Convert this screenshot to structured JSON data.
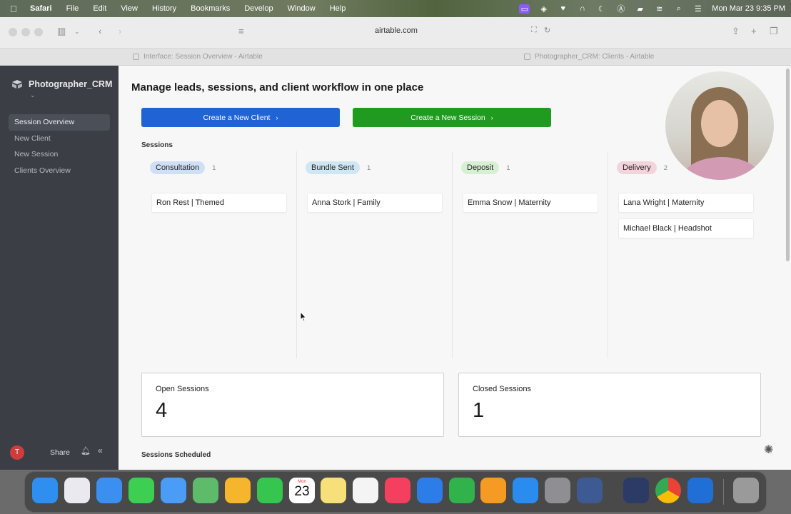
{
  "menubar": {
    "app_name": "Safari",
    "menus": [
      "File",
      "Edit",
      "View",
      "History",
      "Bookmarks",
      "Develop",
      "Window",
      "Help"
    ],
    "clock": "Mon Mar 23  9:35 PM"
  },
  "browser": {
    "url": "airtable.com",
    "tabs": [
      {
        "title": "Interface: Session Overview - Airtable"
      },
      {
        "title": "Photographer_CRM: Clients - Airtable"
      }
    ]
  },
  "sidebar": {
    "app_name": "Photographer_CRM",
    "items": [
      {
        "label": "Session Overview",
        "active": true
      },
      {
        "label": "New Client"
      },
      {
        "label": "New Session"
      },
      {
        "label": "Clients Overview"
      }
    ],
    "avatar_initial": "T",
    "share_label": "Share"
  },
  "main": {
    "title": "Manage leads, sessions, and client workflow in one place",
    "buttons": {
      "new_client": "Create a New Client",
      "new_session": "Create a New Session"
    },
    "sessions_label": "Sessions",
    "columns": [
      {
        "name": "Consultation",
        "count": "1",
        "color": "#cfe0f6",
        "cards": [
          "Ron Rest | Themed"
        ]
      },
      {
        "name": "Bundle Sent",
        "count": "1",
        "color": "#cfe7f3",
        "cards": [
          "Anna Stork | Family"
        ]
      },
      {
        "name": "Deposit",
        "count": "1",
        "color": "#d7efd3",
        "cards": [
          "Emma Snow | Maternity"
        ]
      },
      {
        "name": "Delivery",
        "count": "2",
        "color": "#f3d4dd",
        "cards": [
          "Lana Wright | Maternity",
          "Michael Black | Headshot"
        ]
      }
    ],
    "stats": {
      "open_label": "Open Sessions",
      "open_value": "4",
      "closed_label": "Closed Sessions",
      "closed_value": "1"
    },
    "scheduled_label": "Sessions Scheduled"
  },
  "dock": {
    "calendar_month": "Mon",
    "calendar_day": "23",
    "apps": [
      {
        "icon": "finder-icon",
        "color": "#2f8ff0"
      },
      {
        "icon": "launchpad-icon",
        "color": "#e9e9ef"
      },
      {
        "icon": "safari-icon",
        "color": "#3a8ff0"
      },
      {
        "icon": "messages-icon",
        "color": "#3ccf52"
      },
      {
        "icon": "mail-icon",
        "color": "#4a9cf6"
      },
      {
        "icon": "maps-icon",
        "color": "#5dbb6a"
      },
      {
        "icon": "photos-icon",
        "color": "#f5b52c"
      },
      {
        "icon": "facetime-icon",
        "color": "#36c64f"
      },
      {
        "icon": "calendar-icon",
        "color": "#ffffff"
      },
      {
        "icon": "notes-icon",
        "color": "#f7e07a"
      },
      {
        "icon": "freeform-icon",
        "color": "#f4f4f4"
      },
      {
        "icon": "music-icon",
        "color": "#f43f5e"
      },
      {
        "icon": "keynote-icon",
        "color": "#2d7de8"
      },
      {
        "icon": "numbers-icon",
        "color": "#32b24a"
      },
      {
        "icon": "pages-icon",
        "color": "#f59a23"
      },
      {
        "icon": "app-store-icon",
        "color": "#2b8cf0"
      },
      {
        "icon": "system-settings-icon",
        "color": "#8e8e93"
      },
      {
        "icon": "simulator-icon",
        "color": "#2b3b66"
      },
      {
        "icon": "finder-utility-icon",
        "color": "#3d5a92"
      },
      {
        "icon": "chrome-icon",
        "color": "#f2f2f2"
      },
      {
        "icon": "snowflake-app-icon",
        "color": "#1f6fd6"
      },
      {
        "icon": "trash-icon",
        "color": "#9a9a9a"
      }
    ]
  }
}
